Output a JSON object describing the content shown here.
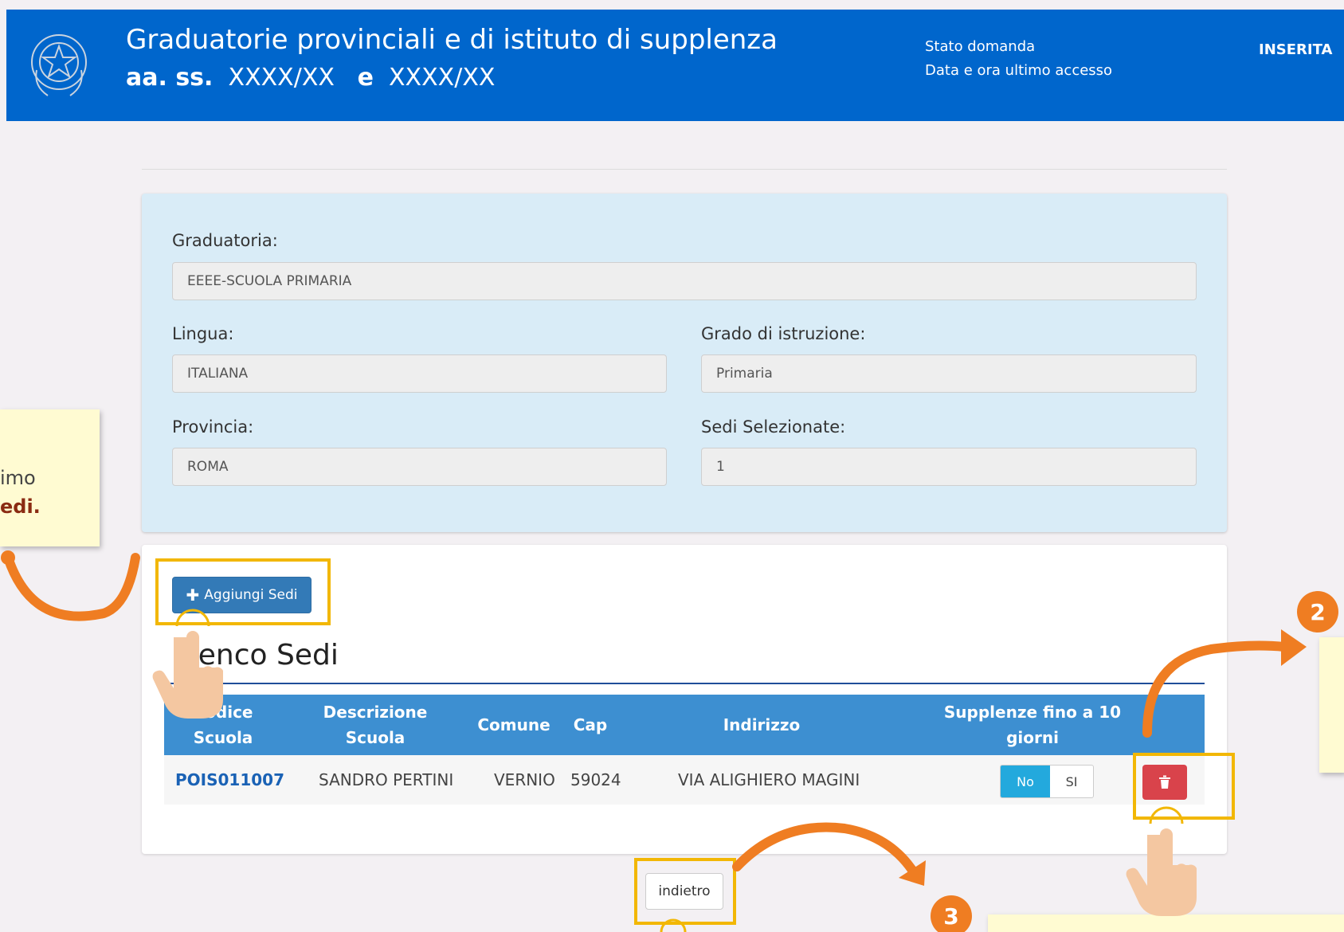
{
  "header": {
    "title_line1": "Graduatorie provinciali e di istituto di supplenza",
    "academic_prefix": "aa. ss.",
    "year_from": "XXXX/XX",
    "connector": "e",
    "year_to": "XXXX/XX",
    "status_label": "Stato domanda",
    "last_access_label": "Data e ora ultimo accesso",
    "status_value": "INSERITA"
  },
  "form": {
    "graduatoria_label": "Graduatoria:",
    "graduatoria_value": "EEEE-SCUOLA PRIMARIA",
    "lingua_label": "Lingua:",
    "lingua_value": "ITALIANA",
    "grado_label": "Grado di istruzione:",
    "grado_value": "Primaria",
    "provincia_label": "Provincia:",
    "provincia_value": "ROMA",
    "sedi_label": "Sedi Selezionate:",
    "sedi_value": "1"
  },
  "sedi": {
    "add_button_label": "Aggiungi Sedi",
    "list_title": "Elenco Sedi",
    "columns": {
      "codice": "Codice Scuola",
      "descrizione": "Descrizione Scuola",
      "comune": "Comune",
      "cap": "Cap",
      "indirizzo": "Indirizzo",
      "supplenze": "Supplenze fino a 10 giorni"
    },
    "row": {
      "codice": "POIS011007",
      "descrizione": "SANDRO PERTINI",
      "comune": "VERNIO",
      "cap": "59024",
      "indirizzo": "VIA ALIGHIERO MAGINI",
      "toggle_no": "No",
      "toggle_si": "SI"
    }
  },
  "nav": {
    "back_label": "indietro"
  },
  "callouts": {
    "left_text": "imo",
    "left_strong": "edi.",
    "step2": "2",
    "step3": "3"
  },
  "colors": {
    "header_blue": "#0066cc",
    "table_head_blue": "#3d8fd1",
    "highlight_yellow": "#f2b705",
    "arrow_orange": "#ef7d22",
    "delete_red": "#d9434b"
  }
}
